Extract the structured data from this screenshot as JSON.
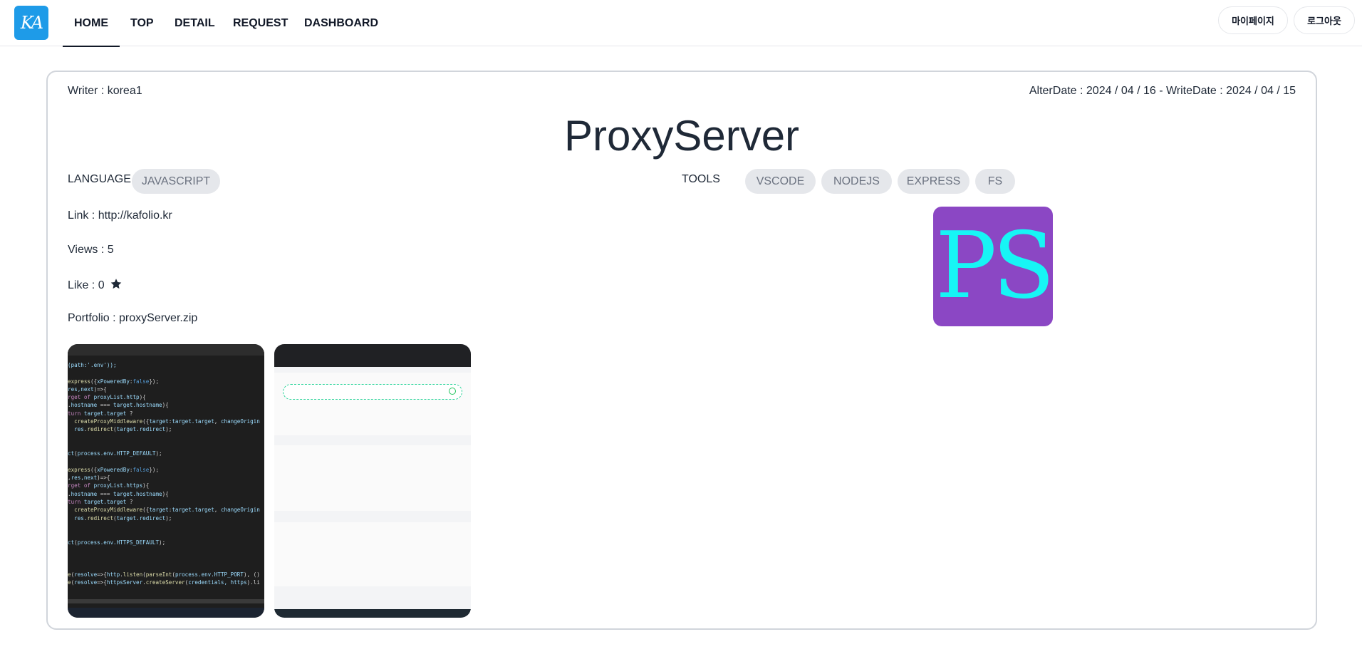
{
  "nav": {
    "logo_text": "KA",
    "items": [
      {
        "label": "HOME",
        "active": true
      },
      {
        "label": "TOP"
      },
      {
        "label": "DETAIL"
      },
      {
        "label": "REQUEST"
      },
      {
        "label": "DASHBOARD"
      }
    ],
    "mypage_label": "마이페이지",
    "logout_label": "로그아웃"
  },
  "post": {
    "writer": "Writer : korea1",
    "dates": "AlterDate : 2024 / 04 / 16 - WriteDate : 2024 / 04 / 15",
    "title": "ProxyServer",
    "language_label": "LANGUAGE",
    "languages": [
      "JAVASCRIPT"
    ],
    "tools_label": "TOOLS",
    "tools": [
      "VSCODE",
      "NODEJS",
      "EXPRESS",
      "FS"
    ],
    "link": "Link : http://kafolio.kr",
    "views": "Views : 5",
    "like": "Like : 0",
    "portfolio": "Portfolio : proxyServer.zip",
    "thumbnail_text": "PS"
  },
  "colors": {
    "logo_bg": "#1e9be8",
    "thumbnail_bg": "#8b47c4",
    "thumbnail_text": "#17f5f5",
    "chip_bg": "#e5e7eb"
  },
  "icons": {
    "like": "star-icon"
  }
}
